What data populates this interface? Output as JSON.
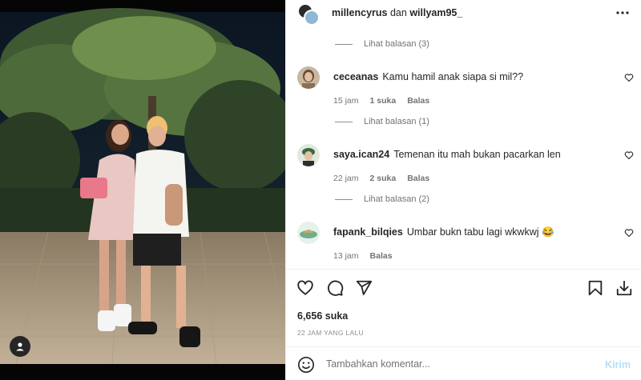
{
  "header": {
    "user_one": "millencyrus",
    "connector": "dan",
    "user_two": "willyam95_"
  },
  "replies_toggle": [
    {
      "label": "Lihat balasan (3)"
    },
    {
      "label": "Lihat balasan (1)"
    },
    {
      "label": "Lihat balasan (2)"
    }
  ],
  "comments": [
    {
      "user": "ceceanas",
      "text": "Kamu hamil anak siapa si mil??",
      "time": "15 jam",
      "likes": "1 suka",
      "reply": "Balas"
    },
    {
      "user": "saya.ican24",
      "text": "Temenan itu mah bukan pacarkan len",
      "time": "22 jam",
      "likes": "2 suka",
      "reply": "Balas"
    },
    {
      "user": "fapank_bilqies",
      "text": "Umbar bukn tabu lagi wkwkwj 😂",
      "time": "13 jam",
      "likes": "",
      "reply": "Balas"
    }
  ],
  "post": {
    "likes": "6,656 suka",
    "time_ago": "22 JAM YANG LALU"
  },
  "composer": {
    "placeholder": "Tambahkan komentar...",
    "post_label": "Kirim"
  },
  "colors": {
    "link_disabled": "#b2dffc",
    "muted": "#737373",
    "text": "#262626"
  },
  "icons": [
    "more-icon",
    "heart-icon",
    "comment-icon",
    "share-icon",
    "bookmark-icon",
    "download-icon",
    "emoji-icon",
    "user-tag-icon"
  ]
}
